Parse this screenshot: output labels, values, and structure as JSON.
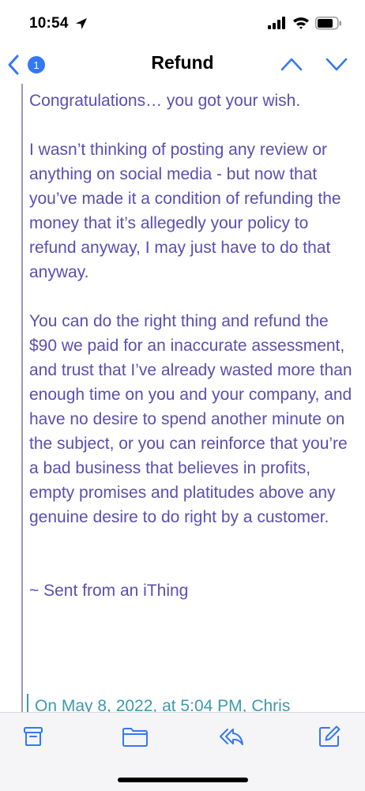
{
  "status_bar": {
    "time": "10:54"
  },
  "nav": {
    "title": "Refund",
    "unread_badge": "1"
  },
  "message": {
    "paragraphs": [
      "Congratulations… you got your wish.",
      "I wasn’t thinking of posting any review or anything on social media - but now that you’ve made it a condition of refunding the money that it’s allegedly your policy to refund anyway, I may just have to do that anyway.",
      "You can do the right thing and refund the $90 we paid for an inaccurate assessment, and trust that I’ve already wasted more than enough time on you and your company, and have no desire to spend another minute on the subject, or you can reinforce that you’re a bad business that believes in profits, empty promises and platitudes above any genuine desire to do right by a customer."
    ],
    "signature": "~ Sent from an iThing",
    "quoted_header": "On May 8, 2022, at 5:04 PM, Chris"
  },
  "toolbar": {
    "icons": [
      "archive-icon",
      "folder-icon",
      "reply-icon",
      "compose-icon"
    ]
  },
  "colors": {
    "accent": "#3478f6",
    "message_text": "#5a4fb0",
    "quote_text": "#3f98b0"
  }
}
